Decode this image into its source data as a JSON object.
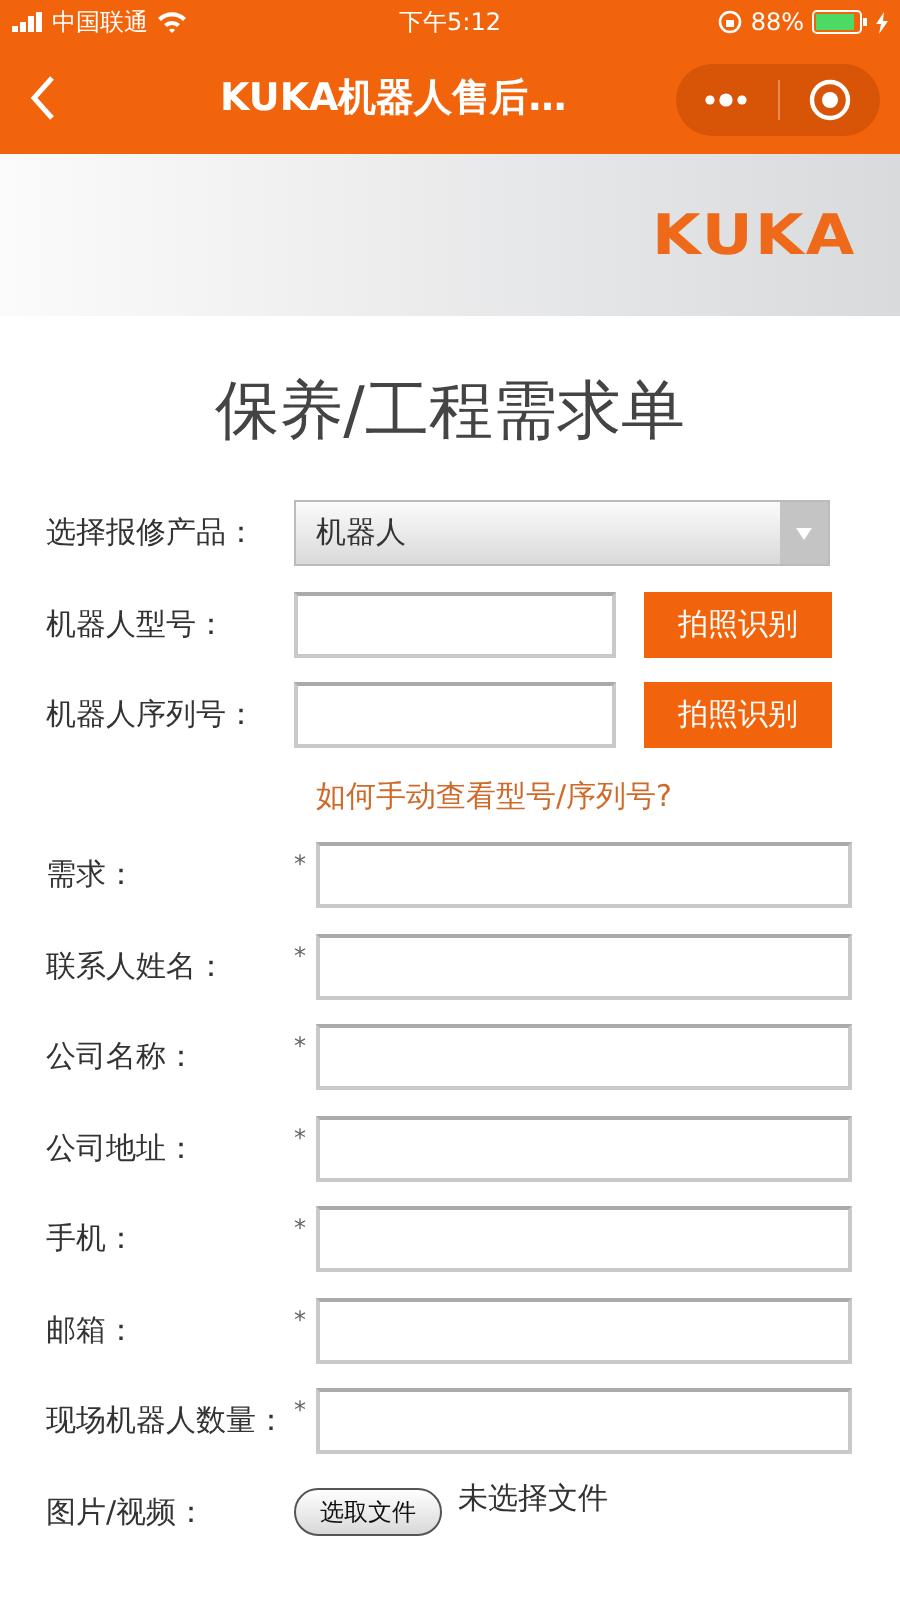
{
  "status_bar": {
    "carrier": "中国联通",
    "time": "下午5:12",
    "battery": "88%"
  },
  "nav": {
    "title": "KUKA机器人售后…"
  },
  "banner": {
    "logo": "KUKA"
  },
  "form": {
    "title": "保养/工程需求单",
    "rows": [
      {
        "kind": "select",
        "label": "选择报修产品：",
        "value": "机器人"
      },
      {
        "kind": "scan",
        "label": "机器人型号：",
        "button": "拍照识别"
      },
      {
        "kind": "scan",
        "label": "机器人序列号：",
        "button": "拍照识别"
      },
      {
        "kind": "link",
        "text": "如何手动查看型号/序列号?"
      },
      {
        "kind": "text",
        "label": "需求：",
        "required": "*"
      },
      {
        "kind": "text",
        "label": "联系人姓名：",
        "required": "*"
      },
      {
        "kind": "text",
        "label": "公司名称：",
        "required": "*"
      },
      {
        "kind": "text",
        "label": "公司地址：",
        "required": "*"
      },
      {
        "kind": "text",
        "label": "手机：",
        "required": "*"
      },
      {
        "kind": "text",
        "label": "邮箱：",
        "required": "*"
      },
      {
        "kind": "text",
        "label": "现场机器人数量：",
        "required": "*"
      },
      {
        "kind": "file",
        "label": "图片/视频：",
        "button": "选取文件",
        "status": "未选择文件"
      }
    ]
  }
}
